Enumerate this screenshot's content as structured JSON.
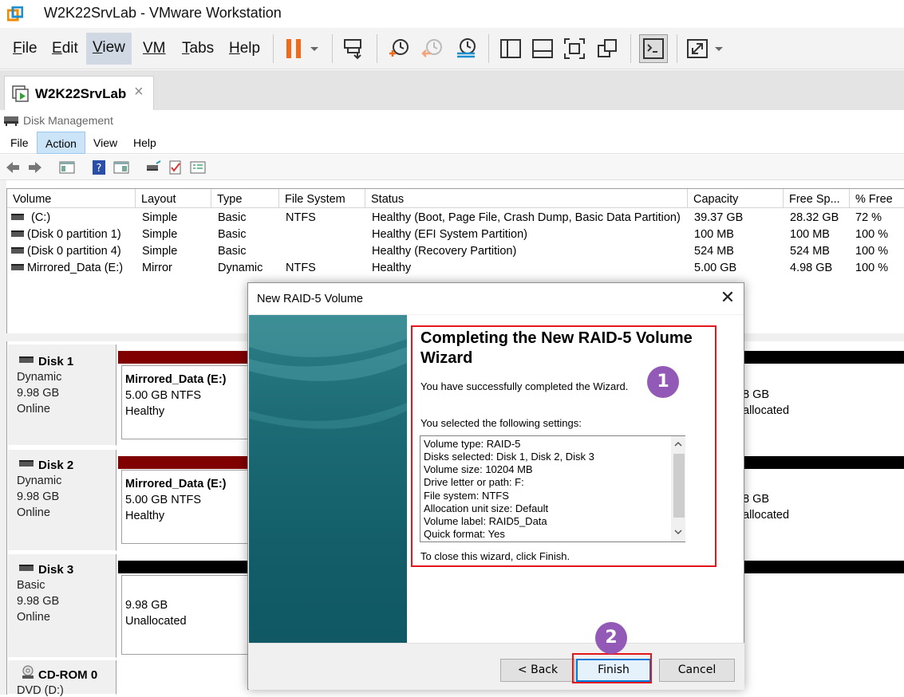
{
  "app": {
    "window_title": "W2K22SrvLab - VMware Workstation",
    "menu": [
      {
        "label": "File",
        "mnemonic": "F",
        "rest": "ile"
      },
      {
        "label": "Edit",
        "mnemonic": "E",
        "rest": "dit"
      },
      {
        "label": "View",
        "mnemonic": "V",
        "rest": "iew"
      },
      {
        "label": "VM",
        "mnemonic": "",
        "rest": "VM"
      },
      {
        "label": "Tabs",
        "mnemonic": "T",
        "rest": "abs"
      },
      {
        "label": "Help",
        "mnemonic": "H",
        "rest": "elp"
      }
    ],
    "toolbar_icons": [
      "pause-icon",
      "dropdown-icon",
      "send-ctrl-alt-del-icon",
      "snapshot-take-icon",
      "snapshot-revert-icon",
      "snapshot-manager-icon",
      "library-icon",
      "thumbnail-bar-icon",
      "fullscreen-icon",
      "unity-icon",
      "console-view-icon",
      "stretch-guest-icon",
      "stretch-dropdown-icon"
    ],
    "tab": {
      "label": "W2K22SrvLab",
      "close": "×"
    }
  },
  "disk_mgmt": {
    "title": "Disk Management",
    "menu": [
      "File",
      "Action",
      "View",
      "Help"
    ],
    "columns": [
      "Volume",
      "Layout",
      "Type",
      "File System",
      "Status",
      "Capacity",
      "Free Sp...",
      "% Free"
    ],
    "volumes": [
      {
        "volume": "(C:)",
        "layout": "Simple",
        "type": "Basic",
        "fs": "NTFS",
        "status": "Healthy (Boot, Page File, Crash Dump, Basic Data Partition)",
        "capacity": "39.37 GB",
        "free": "28.32 GB",
        "pct": "72 %"
      },
      {
        "volume": "(Disk 0 partition 1)",
        "layout": "Simple",
        "type": "Basic",
        "fs": "",
        "status": "Healthy (EFI System Partition)",
        "capacity": "100 MB",
        "free": "100 MB",
        "pct": "100 %"
      },
      {
        "volume": "(Disk 0 partition 4)",
        "layout": "Simple",
        "type": "Basic",
        "fs": "",
        "status": "Healthy (Recovery Partition)",
        "capacity": "524 MB",
        "free": "524 MB",
        "pct": "100 %"
      },
      {
        "volume": "Mirrored_Data (E:)",
        "layout": "Mirror",
        "type": "Dynamic",
        "fs": "NTFS",
        "status": "Healthy",
        "capacity": "5.00 GB",
        "free": "4.98 GB",
        "pct": "100 %"
      }
    ],
    "disks": [
      {
        "name": "Disk 1",
        "type": "Dynamic",
        "size": "9.98 GB",
        "state": "Online",
        "part_name": "Mirrored_Data  (E:)",
        "part_size": "5.00 GB NTFS",
        "part_status": "Healthy",
        "right_size": "8 GB",
        "right_status": "allocated"
      },
      {
        "name": "Disk 2",
        "type": "Dynamic",
        "size": "9.98 GB",
        "state": "Online",
        "part_name": "Mirrored_Data  (E:)",
        "part_size": "5.00 GB NTFS",
        "part_status": "Healthy",
        "right_size": "8 GB",
        "right_status": "allocated"
      },
      {
        "name": "Disk 3",
        "type": "Basic",
        "size": "9.98 GB",
        "state": "Online",
        "part_size": "9.98 GB",
        "part_status": "Unallocated"
      },
      {
        "name": "CD-ROM 0",
        "type": "DVD (D:)"
      }
    ],
    "colors": {
      "mirror_bar": "#800000",
      "unalloc_bar": "#000000"
    }
  },
  "wizard": {
    "title": "New RAID-5 Volume",
    "close": "✕",
    "heading": "Completing the New RAID-5 Volume Wizard",
    "success": "You have successfully completed the Wizard.",
    "settings_intro": "You selected the following settings:",
    "settings": [
      "Volume type: RAID-5",
      "Disks selected: Disk 1, Disk 2, Disk 3",
      "Volume size: 10204 MB",
      "Drive letter or path: F:",
      "File system: NTFS",
      "Allocation unit size: Default",
      "Volume label: RAID5_Data",
      "Quick format: Yes"
    ],
    "close_hint": "To close this wizard, click Finish.",
    "buttons": {
      "back": "< Back",
      "finish": "Finish",
      "cancel": "Cancel"
    }
  },
  "annotations": {
    "badge1": "1",
    "badge2": "2",
    "color": "#9359b6",
    "box_color": "#e3161c"
  }
}
